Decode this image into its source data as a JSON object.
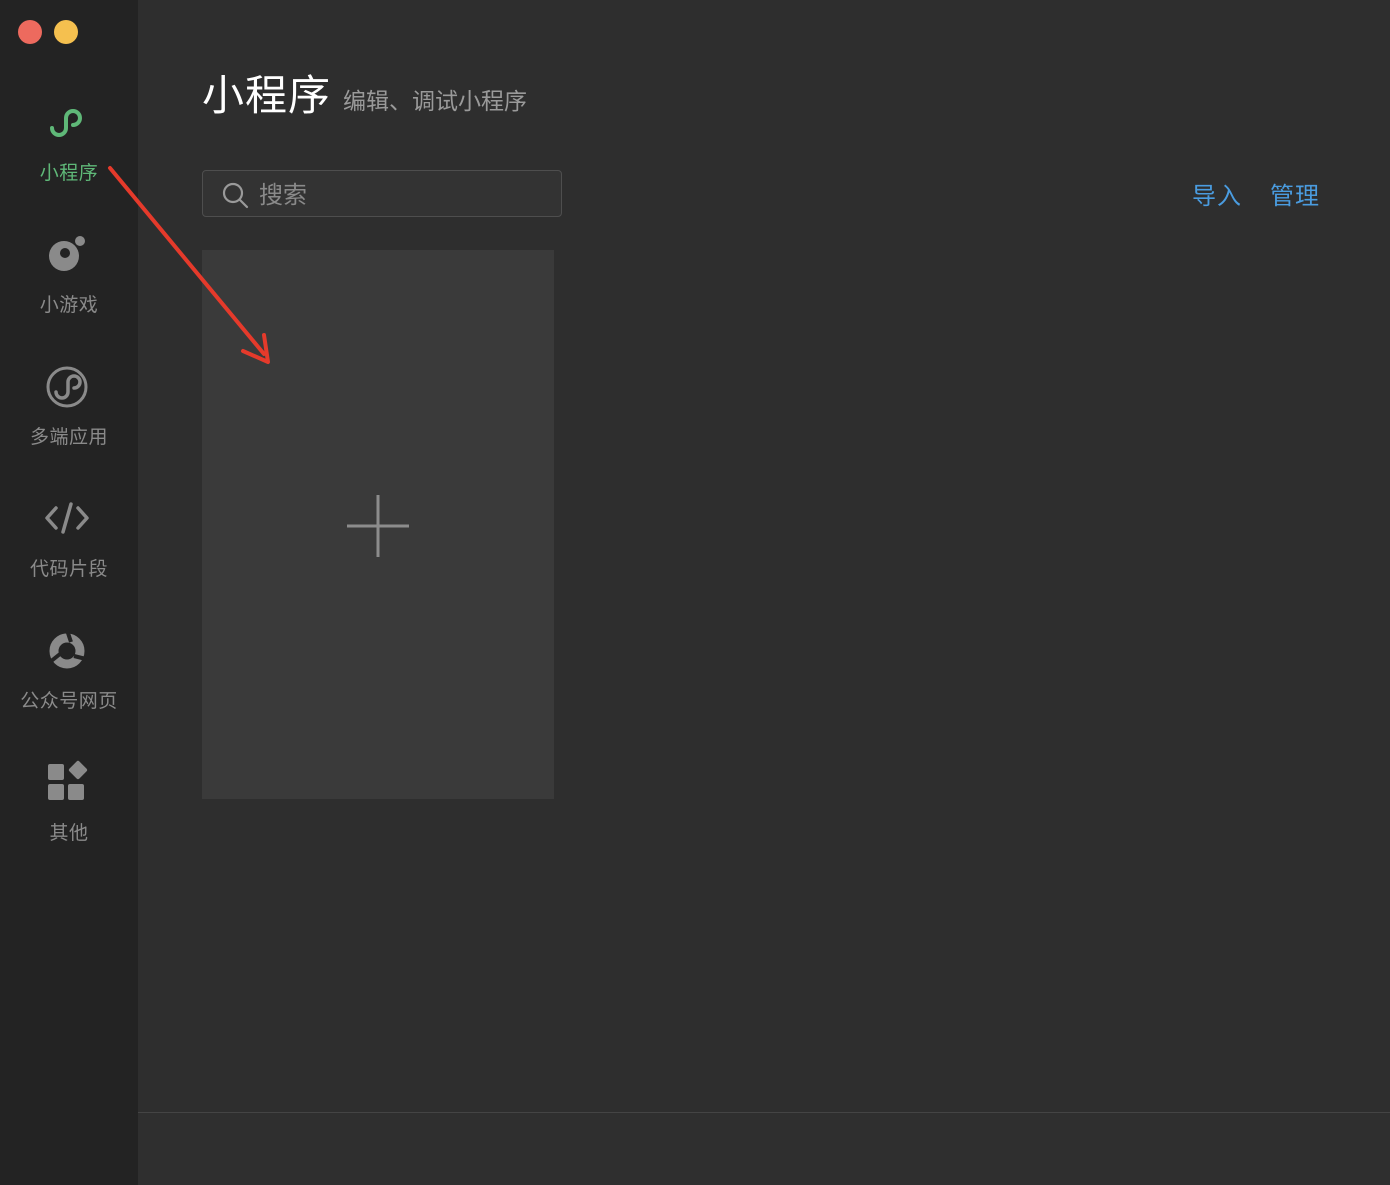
{
  "colors": {
    "close": "#ed6a5e",
    "minimize": "#f5c04f",
    "accent_green": "#5fb878",
    "link_blue": "#4a9ce0",
    "annotation_red": "#e53a2b"
  },
  "sidebar": {
    "items": [
      {
        "label": "小程序",
        "icon": "miniprogram-icon",
        "active": true
      },
      {
        "label": "小游戏",
        "icon": "minigame-icon",
        "active": false
      },
      {
        "label": "多端应用",
        "icon": "multiplatform-icon",
        "active": false
      },
      {
        "label": "代码片段",
        "icon": "code-icon",
        "active": false
      },
      {
        "label": "公众号网页",
        "icon": "official-account-icon",
        "active": false
      },
      {
        "label": "其他",
        "icon": "apps-icon",
        "active": false
      }
    ]
  },
  "main": {
    "title": "小程序",
    "subtitle": "编辑、调试小程序",
    "search": {
      "placeholder": "搜索",
      "value": ""
    },
    "actions": {
      "import_label": "导入",
      "manage_label": "管理"
    },
    "new_project": {
      "icon": "plus-icon"
    }
  }
}
